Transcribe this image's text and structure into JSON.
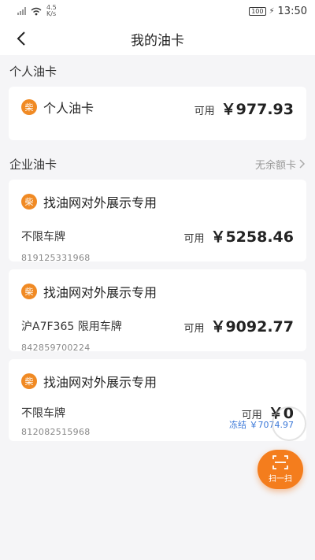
{
  "status_bar": {
    "speed_value": "4.5",
    "speed_unit": "K/s",
    "battery": "100",
    "time": "13:50"
  },
  "nav": {
    "title": "我的油卡"
  },
  "personal": {
    "section_title": "个人油卡",
    "card": {
      "badge": "柴",
      "name": "个人油卡",
      "available_label": "可用",
      "amount": "￥977.93"
    }
  },
  "enterprise": {
    "section_title": "企业油卡",
    "link_label": "无余额卡",
    "cards": [
      {
        "badge": "柴",
        "name": "找油网对外展示专用",
        "plate": "不限车牌",
        "card_no": "819125331968",
        "available_label": "可用",
        "amount": "￥5258.46"
      },
      {
        "badge": "柴",
        "name": "找油网对外展示专用",
        "plate": "沪A7F365 限用车牌",
        "card_no": "842859700224",
        "available_label": "可用",
        "amount": "￥9092.77"
      },
      {
        "badge": "柴",
        "name": "找油网对外展示专用",
        "plate": "不限车牌",
        "card_no": "812082515968",
        "available_label": "可用",
        "amount": "￥0",
        "frozen_label": "冻结",
        "frozen_amount": "￥7074.97"
      }
    ]
  },
  "scan_button": {
    "label": "扫一扫"
  },
  "colors": {
    "accent": "#f47d1d",
    "badge": "#f08a24",
    "frozen": "#3b78d8"
  }
}
